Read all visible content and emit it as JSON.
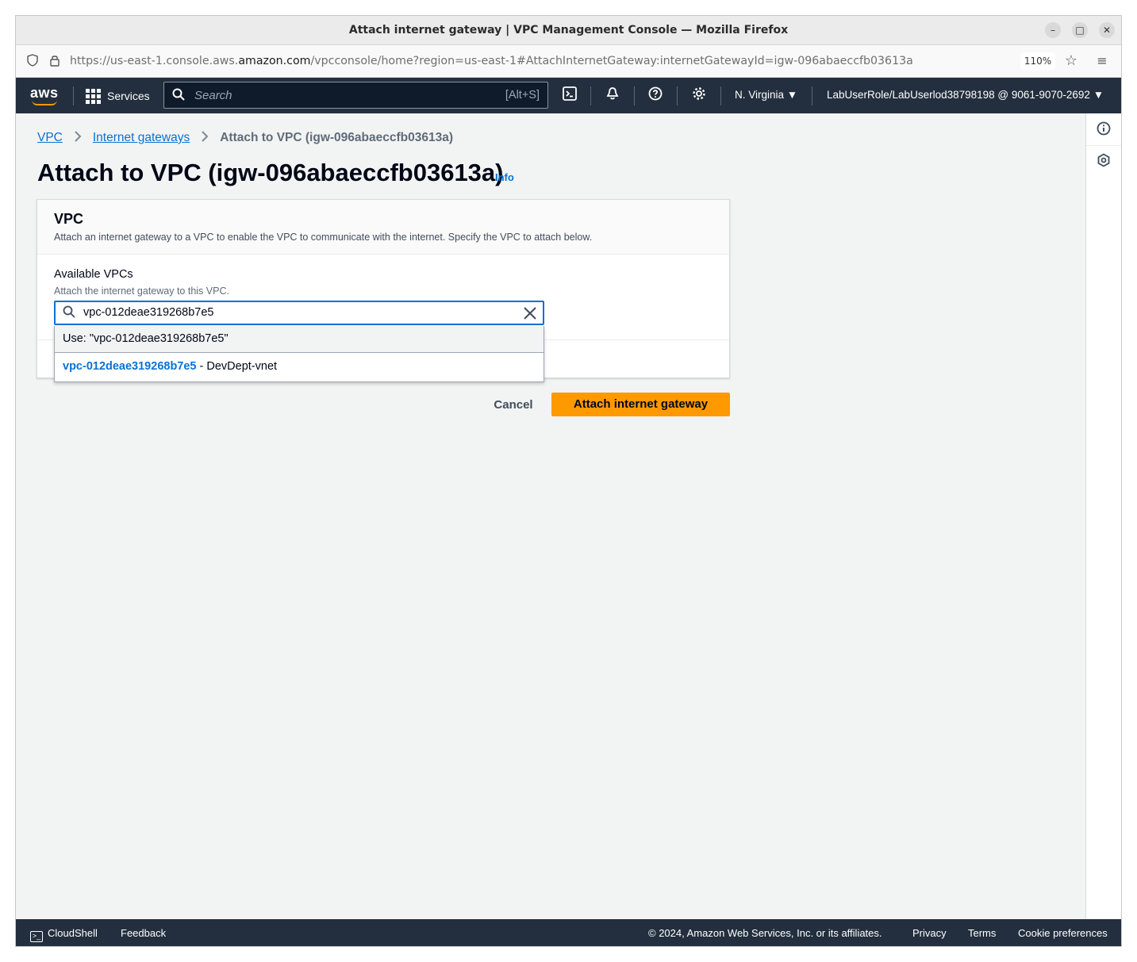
{
  "browser": {
    "window_title": "Attach internet gateway | VPC Management Console — Mozilla Firefox",
    "url_prefix": "https://us-east-1.console.aws.",
    "url_domain": "amazon.com",
    "url_suffix": "/vpcconsole/home?region=us-east-1#AttachInternetGateway:internetGatewayId=igw-096abaeccfb03613a",
    "zoom": "110%",
    "controls": {
      "minimize": "–",
      "maximize": "□",
      "close": "✕"
    }
  },
  "awsnav": {
    "logo": "aws",
    "services_label": "Services",
    "search_placeholder": "Search",
    "search_shortcut": "[Alt+S]",
    "region": "N. Virginia ▼",
    "account": "LabUserRole/LabUserlod38798198 @ 9061-9070-2692 ▼"
  },
  "breadcrumb": {
    "items": [
      "VPC",
      "Internet gateways",
      "Attach to VPC (igw-096abaeccfb03613a)"
    ]
  },
  "page": {
    "title": "Attach to VPC (igw-096abaeccfb03613a)",
    "info_link": "Info"
  },
  "panel": {
    "heading": "VPC",
    "description": "Attach an internet gateway to a VPC to enable the VPC to communicate with the internet. Specify the VPC to attach below.",
    "field_label": "Available VPCs",
    "field_description": "Attach the internet gateway to this VPC.",
    "input_value": "vpc-012deae319268b7e5",
    "dropdown": {
      "use_option": "Use: \"vpc-012deae319268b7e5\"",
      "vpc_option_id": "vpc-012deae319268b7e5",
      "vpc_option_name": " - DevDept-vnet"
    }
  },
  "actions": {
    "cancel": "Cancel",
    "primary": "Attach internet gateway"
  },
  "footer": {
    "cloudshell": "CloudShell",
    "feedback": "Feedback",
    "copyright": "© 2024, Amazon Web Services, Inc. or its affiliates.",
    "privacy": "Privacy",
    "terms": "Terms",
    "cookie": "Cookie preferences"
  },
  "colors": {
    "nav_bg": "#232f3e",
    "accent_orange": "#ff9900",
    "link_blue": "#0972d3"
  }
}
